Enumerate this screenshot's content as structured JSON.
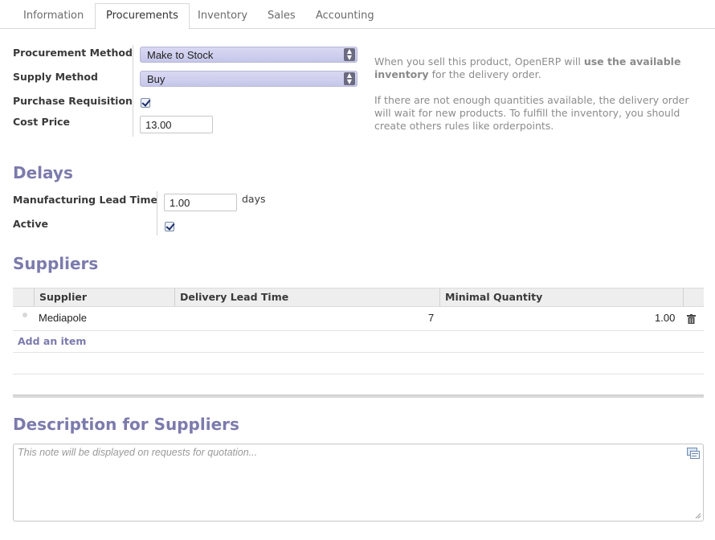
{
  "tabs": [
    "Information",
    "Procurements",
    "Inventory",
    "Sales",
    "Accounting"
  ],
  "active_tab": "Procurements",
  "procurement": {
    "method_label": "Procurement Method",
    "method_value": "Make to Stock",
    "supply_label": "Supply Method",
    "supply_value": "Buy",
    "requisition_label": "Purchase Requisition",
    "requisition_checked": true,
    "cost_label": "Cost Price",
    "cost_value": "13.00"
  },
  "help": {
    "p1_pre": "When you sell this product, OpenERP will ",
    "p1_bold": "use the available inventory",
    "p1_post": " for the delivery order.",
    "p2": "If there are not enough quantities available, the delivery order will wait for new products. To fulfill the inventory, you should create others rules like orderpoints."
  },
  "delays": {
    "title": "Delays",
    "lead_label": "Manufacturing Lead Time",
    "lead_value": "1.00",
    "lead_unit": "days",
    "active_label": "Active",
    "active_checked": true
  },
  "suppliers": {
    "title": "Suppliers",
    "headers": [
      "Supplier",
      "Delivery Lead Time",
      "Minimal Quantity"
    ],
    "rows": [
      {
        "supplier": "Mediapole",
        "lead_time": "7",
        "min_qty": "1.00"
      }
    ],
    "add_item": "Add an item"
  },
  "description": {
    "title": "Description for Suppliers",
    "placeholder": "This note will be displayed on requests for quotation..."
  },
  "colors": {
    "accent": "#7c7bad",
    "select": "#c6c6ea"
  }
}
